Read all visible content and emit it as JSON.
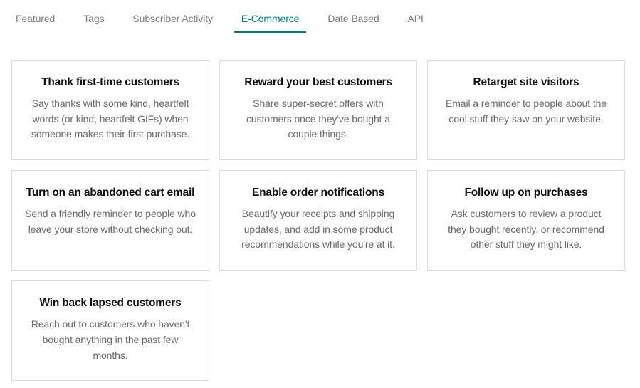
{
  "tabs": [
    {
      "label": "Featured",
      "active": false
    },
    {
      "label": "Tags",
      "active": false
    },
    {
      "label": "Subscriber Activity",
      "active": false
    },
    {
      "label": "E-Commerce",
      "active": true
    },
    {
      "label": "Date Based",
      "active": false
    },
    {
      "label": "API",
      "active": false
    }
  ],
  "cards": [
    {
      "title": "Thank first-time customers",
      "desc": "Say thanks with some kind, heartfelt words (or kind, heartfelt GIFs) when someone makes their first purchase."
    },
    {
      "title": "Reward your best customers",
      "desc": "Share super-secret offers with customers once they've bought a couple things."
    },
    {
      "title": "Retarget site visitors",
      "desc": "Email a reminder to people about the cool stuff they saw on your website."
    },
    {
      "title": "Turn on an abandoned cart email",
      "desc": "Send a friendly reminder to people who leave your store without checking out."
    },
    {
      "title": "Enable order notifications",
      "desc": "Beautify your receipts and shipping updates, and add in some product recommendations while you're at it."
    },
    {
      "title": "Follow up on purchases",
      "desc": "Ask customers to review a product they bought recently, or recommend other stuff they might like."
    },
    {
      "title": "Win back lapsed customers",
      "desc": "Reach out to customers who haven't bought anything in the past few months."
    }
  ]
}
